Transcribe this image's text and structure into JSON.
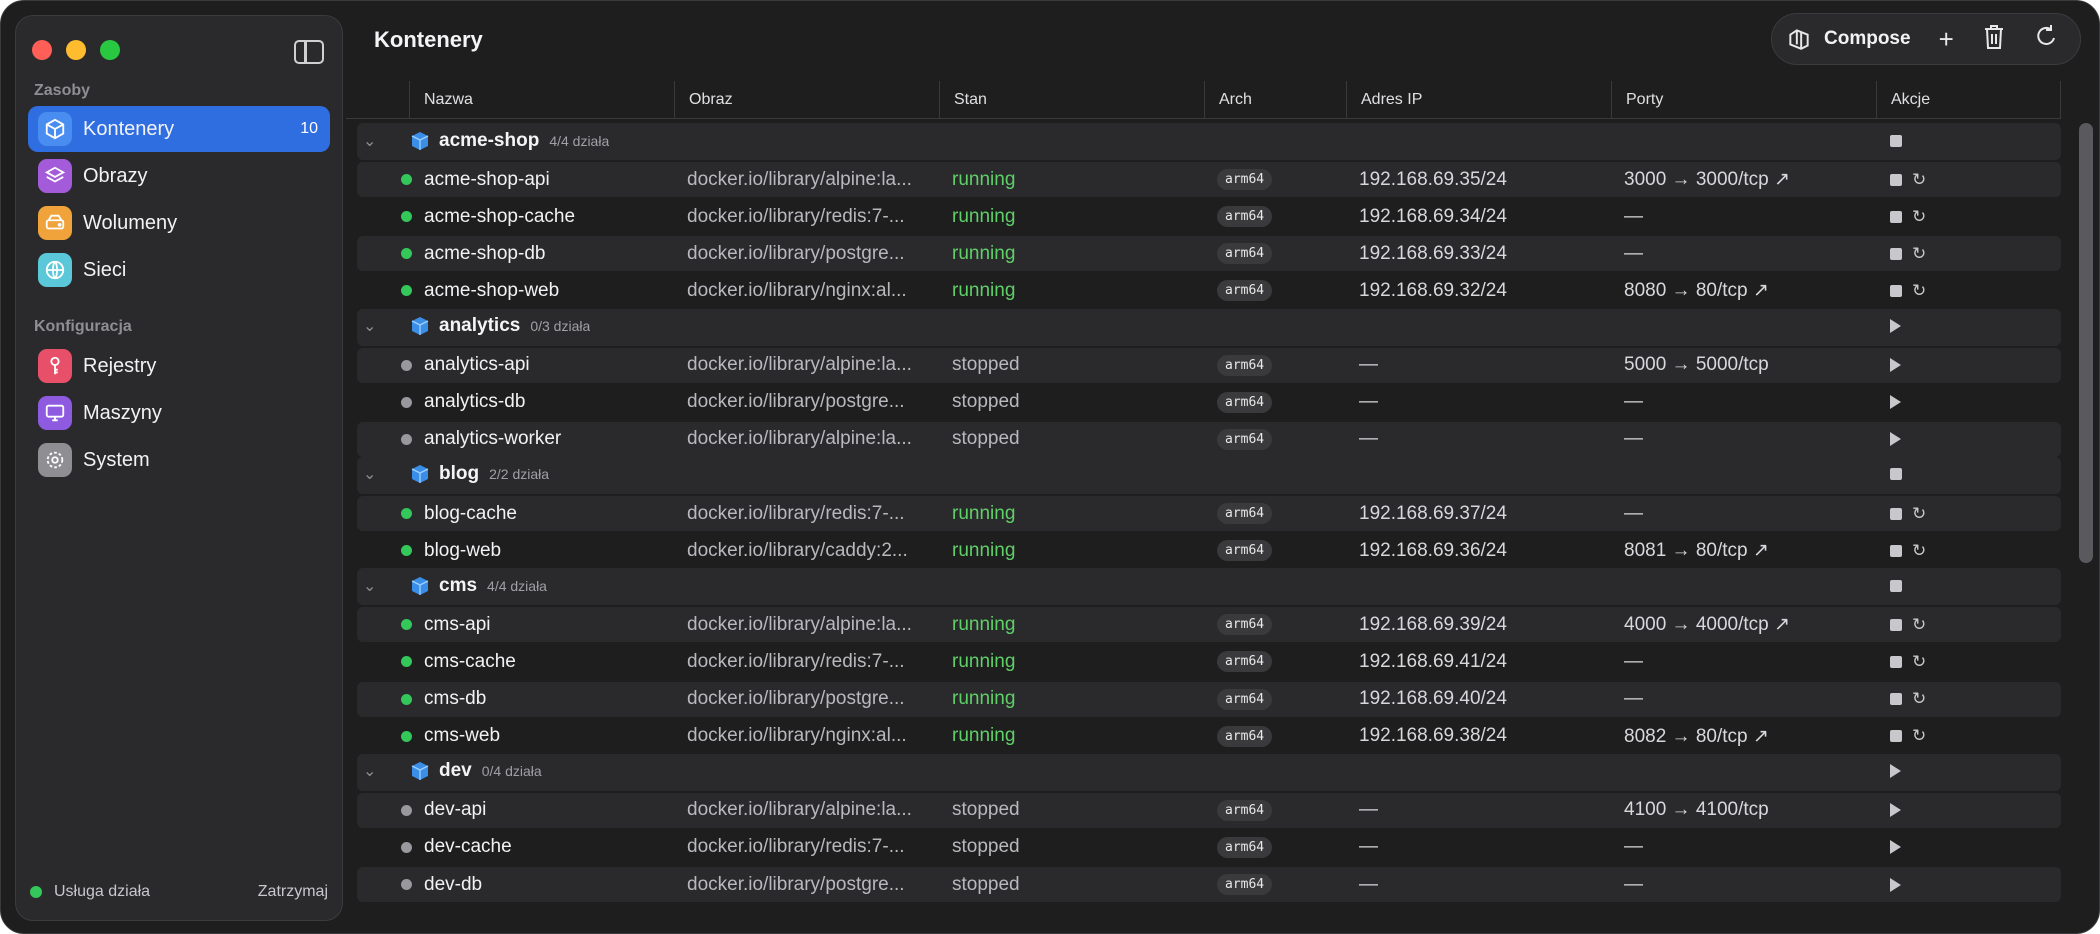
{
  "sidebar": {
    "sections": [
      {
        "label": "Zasoby"
      },
      {
        "label": "Konfiguracja"
      }
    ],
    "items": [
      {
        "label": "Kontenery",
        "count": "10",
        "icon": "container-icon",
        "color": "#4a8df0",
        "active": true
      },
      {
        "label": "Obrazy",
        "icon": "layers-icon",
        "color": "#a45bd9"
      },
      {
        "label": "Wolumeny",
        "icon": "drive-icon",
        "color": "#f0a23b"
      },
      {
        "label": "Sieci",
        "icon": "globe-icon",
        "color": "#5ac8d8"
      },
      {
        "label": "Rejestry",
        "icon": "key-icon",
        "color": "#e8506a"
      },
      {
        "label": "Maszyny",
        "icon": "monitor-icon",
        "color": "#8e5be0"
      },
      {
        "label": "System",
        "icon": "gear-icon",
        "color": "#8e8e93"
      }
    ],
    "footer": {
      "status": "Usługa działa",
      "stop": "Zatrzymaj"
    }
  },
  "header": {
    "title": "Kontenery",
    "toolbar": {
      "compose": "Compose",
      "add": "+",
      "delete": "trash-icon",
      "refresh": "refresh-icon"
    }
  },
  "table": {
    "columns": [
      "Nazwa",
      "Obraz",
      "Stan",
      "Arch",
      "Adres IP",
      "Porty",
      "Akcje"
    ],
    "groups": [
      {
        "name": "acme-shop",
        "count": "4/4 działa",
        "action": "stop",
        "containers": [
          {
            "name": "acme-shop-api",
            "image": "docker.io/library/alpine:la...",
            "state": "running",
            "arch": "arm64",
            "ip": "192.168.69.35/24",
            "ports": "3000 → 3000/tcp ↗"
          },
          {
            "name": "acme-shop-cache",
            "image": "docker.io/library/redis:7-...",
            "state": "running",
            "arch": "arm64",
            "ip": "192.168.69.34/24",
            "ports": "—"
          },
          {
            "name": "acme-shop-db",
            "image": "docker.io/library/postgre...",
            "state": "running",
            "arch": "arm64",
            "ip": "192.168.69.33/24",
            "ports": "—"
          },
          {
            "name": "acme-shop-web",
            "image": "docker.io/library/nginx:al...",
            "state": "running",
            "arch": "arm64",
            "ip": "192.168.69.32/24",
            "ports": "8080 → 80/tcp ↗"
          }
        ]
      },
      {
        "name": "analytics",
        "count": "0/3 działa",
        "action": "play",
        "containers": [
          {
            "name": "analytics-api",
            "image": "docker.io/library/alpine:la...",
            "state": "stopped",
            "arch": "arm64",
            "ip": "—",
            "ports": "5000 → 5000/tcp"
          },
          {
            "name": "analytics-db",
            "image": "docker.io/library/postgre...",
            "state": "stopped",
            "arch": "arm64",
            "ip": "—",
            "ports": "—"
          },
          {
            "name": "analytics-worker",
            "image": "docker.io/library/alpine:la...",
            "state": "stopped",
            "arch": "arm64",
            "ip": "—",
            "ports": "—"
          }
        ]
      },
      {
        "name": "blog",
        "count": "2/2 działa",
        "action": "stop",
        "containers": [
          {
            "name": "blog-cache",
            "image": "docker.io/library/redis:7-...",
            "state": "running",
            "arch": "arm64",
            "ip": "192.168.69.37/24",
            "ports": "—"
          },
          {
            "name": "blog-web",
            "image": "docker.io/library/caddy:2...",
            "state": "running",
            "arch": "arm64",
            "ip": "192.168.69.36/24",
            "ports": "8081 → 80/tcp ↗"
          }
        ]
      },
      {
        "name": "cms",
        "count": "4/4 działa",
        "action": "stop",
        "containers": [
          {
            "name": "cms-api",
            "image": "docker.io/library/alpine:la...",
            "state": "running",
            "arch": "arm64",
            "ip": "192.168.69.39/24",
            "ports": "4000 → 4000/tcp ↗"
          },
          {
            "name": "cms-cache",
            "image": "docker.io/library/redis:7-...",
            "state": "running",
            "arch": "arm64",
            "ip": "192.168.69.41/24",
            "ports": "—"
          },
          {
            "name": "cms-db",
            "image": "docker.io/library/postgre...",
            "state": "running",
            "arch": "arm64",
            "ip": "192.168.69.40/24",
            "ports": "—"
          },
          {
            "name": "cms-web",
            "image": "docker.io/library/nginx:al...",
            "state": "running",
            "arch": "arm64",
            "ip": "192.168.69.38/24",
            "ports": "8082 → 80/tcp ↗"
          }
        ]
      },
      {
        "name": "dev",
        "count": "0/4 działa",
        "action": "play",
        "containers": [
          {
            "name": "dev-api",
            "image": "docker.io/library/alpine:la...",
            "state": "stopped",
            "arch": "arm64",
            "ip": "—",
            "ports": "4100 → 4100/tcp"
          },
          {
            "name": "dev-cache",
            "image": "docker.io/library/redis:7-...",
            "state": "stopped",
            "arch": "arm64",
            "ip": "—",
            "ports": "—"
          },
          {
            "name": "dev-db",
            "image": "docker.io/library/postgre...",
            "state": "stopped",
            "arch": "arm64",
            "ip": "—",
            "ports": "—"
          }
        ]
      }
    ]
  }
}
